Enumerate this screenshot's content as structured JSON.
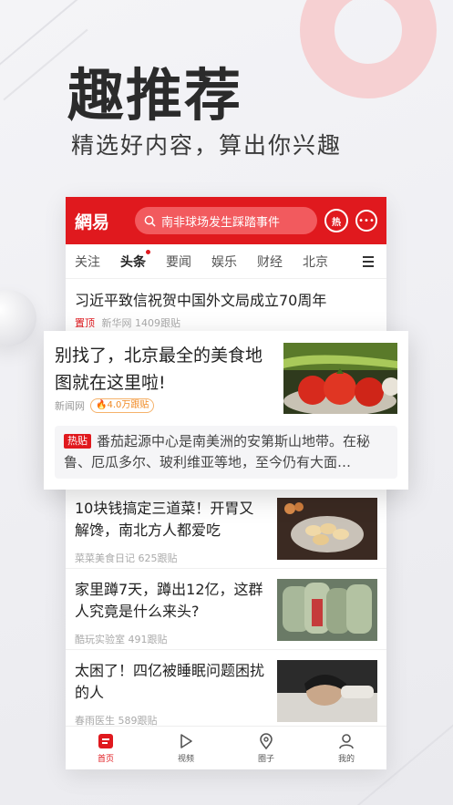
{
  "hero": {
    "title": "趣推荐",
    "subtitle": "精选好内容，算出你兴趣"
  },
  "app": {
    "logo": "網易",
    "search_text": "南非球场发生踩踏事件",
    "hot_button": "热",
    "accent": "#e0191e"
  },
  "tabs": [
    {
      "label": "关注"
    },
    {
      "label": "头条"
    },
    {
      "label": "要闻"
    },
    {
      "label": "娱乐"
    },
    {
      "label": "财经"
    },
    {
      "label": "北京"
    }
  ],
  "pinned": {
    "title": "习近平致信祝贺中国外文局成立70周年",
    "tag": "置顶",
    "source": "新华网",
    "comments": "1409跟贴"
  },
  "featured": {
    "title": "别找了，北京最全的美食地图就在这里啦!",
    "source": "新闻网",
    "comments": "4.0万跟贴",
    "hot_label": "热贴",
    "hot_text": "番茄起源中心是南美洲的安第斯山地带。在秘鲁、厄瓜多尔、玻利维亚等地，至今仍有大面…"
  },
  "feed": [
    {
      "title": "10块钱搞定三道菜！开胃又解馋，南北方人都爱吃",
      "source": "菜菜美食日记",
      "comments": "625跟贴"
    },
    {
      "title": "家里蹲7天，蹲出12亿，这群人究竟是什么来头?",
      "source": "酷玩实验室",
      "comments": "491跟贴"
    },
    {
      "title": "太困了！四亿被睡眠问题困扰的人",
      "source": "春雨医生",
      "comments": "589跟贴"
    }
  ],
  "bottom_nav": [
    {
      "label": "首页",
      "icon": "home-icon"
    },
    {
      "label": "视频",
      "icon": "play-icon"
    },
    {
      "label": "圈子",
      "icon": "location-icon"
    },
    {
      "label": "我的",
      "icon": "user-icon"
    }
  ]
}
